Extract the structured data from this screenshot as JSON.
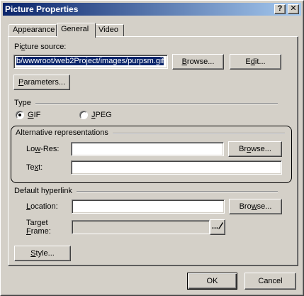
{
  "window": {
    "title": "Picture Properties",
    "help_glyph": "?",
    "close_glyph": "✕"
  },
  "tabs": [
    {
      "label": "Appearance",
      "active": false
    },
    {
      "label": "General",
      "active": true
    },
    {
      "label": "Video",
      "active": false
    }
  ],
  "general": {
    "picture_source": {
      "label_pre": "Pi",
      "label_acc": "c",
      "label_post": "ture source:",
      "value": "b/wwwroot/web2Project/images/purpsm.gif"
    },
    "browse_button": {
      "acc": "B",
      "rest": "rowse..."
    },
    "edit_button": {
      "pre": "E",
      "acc": "d",
      "post": "it..."
    },
    "parameters_button": {
      "acc": "P",
      "rest": "arameters..."
    },
    "type": {
      "label": "Type",
      "gif": {
        "acc": "G",
        "rest": "IF",
        "checked": true
      },
      "jpeg": {
        "acc": "J",
        "rest": "PEG",
        "checked": false
      }
    },
    "alternative": {
      "label": "Alternative representations",
      "lowres_label": {
        "pre": "Lo",
        "acc": "w",
        "post": "-Res:"
      },
      "lowres_value": "",
      "lowres_browse": {
        "pre": "Br",
        "acc": "o",
        "post": "wse..."
      },
      "text_label": {
        "pre": "Te",
        "acc": "x",
        "post": "t:"
      },
      "text_value": ""
    },
    "hyperlink": {
      "label": "Default hyperlink",
      "location_label": {
        "acc": "L",
        "rest": "ocation:"
      },
      "location_value": "",
      "location_browse": {
        "pre": "Bro",
        "acc": "w",
        "post": "se..."
      },
      "target_label_line1": "Target",
      "target_label_line2": {
        "acc": "F",
        "rest": "rame:"
      },
      "target_value": "",
      "target_picker": "..."
    },
    "style_button": {
      "acc": "S",
      "rest": "tyle..."
    }
  },
  "footer": {
    "ok_label": "OK",
    "cancel_label": "Cancel"
  }
}
